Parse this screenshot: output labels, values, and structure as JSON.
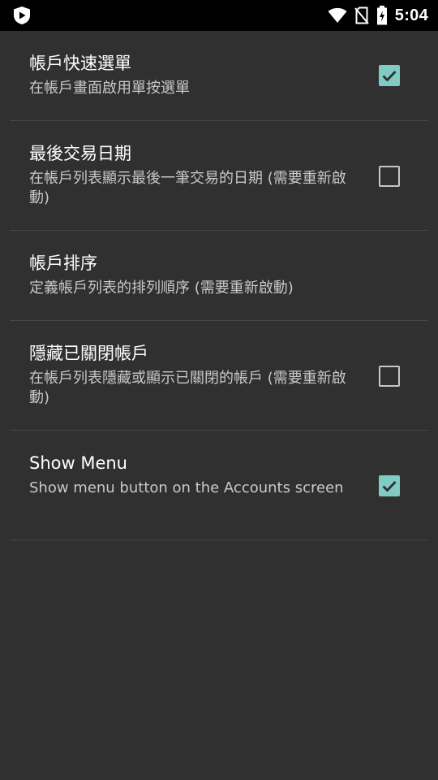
{
  "status_bar": {
    "time": "5:04",
    "icons": [
      "app-shield-icon",
      "wifi-icon",
      "no-sim-icon",
      "battery-charging-icon"
    ]
  },
  "colors": {
    "background": "#303030",
    "status_bar": "#000000",
    "accent": "#80cbc4",
    "divider": "#474747",
    "title_text": "#ffffff",
    "summary_text": "#c8c8c8"
  },
  "preferences": [
    {
      "title": "帳戶快速選單",
      "summary": "在帳戶畫面啟用單按選單",
      "has_checkbox": true,
      "checked": true
    },
    {
      "title": "最後交易日期",
      "summary": "在帳戶列表顯示最後一筆交易的日期 (需要重新啟動)",
      "has_checkbox": true,
      "checked": false
    },
    {
      "title": "帳戶排序",
      "summary": "定義帳戶列表的排列順序 (需要重新啟動)",
      "has_checkbox": false
    },
    {
      "title": "隱藏已關閉帳戶",
      "summary": "在帳戶列表隱藏或顯示已關閉的帳戶 (需要重新啟動)",
      "has_checkbox": true,
      "checked": false
    },
    {
      "title": "Show Menu",
      "summary": "Show menu button on the Accounts screen",
      "has_checkbox": true,
      "checked": true
    }
  ]
}
